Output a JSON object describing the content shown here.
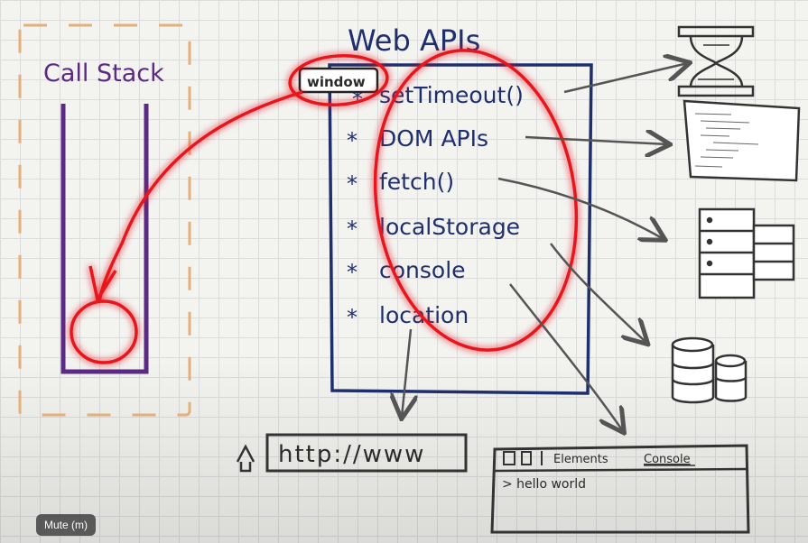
{
  "whiteboard": {
    "call_stack_label": "Call Stack",
    "web_apis_title": "Web APIs",
    "window_label": "window",
    "api_items": [
      {
        "label": "setTimeout()"
      },
      {
        "label": "DOM APIs"
      },
      {
        "label": "fetch()"
      },
      {
        "label": "localStorage"
      },
      {
        "label": "console"
      },
      {
        "label": "location"
      }
    ],
    "bullet_mark": "*",
    "url_text": "http://www",
    "devtools": {
      "tab_elements": "Elements",
      "tab_console": "Console",
      "console_line": "> hello world"
    },
    "colors": {
      "call_stack": "#5a2a86",
      "web_apis": "#1f2f6e",
      "highlight": "#e8141b"
    }
  },
  "player": {
    "mute_button_label": "Mute (m)"
  }
}
